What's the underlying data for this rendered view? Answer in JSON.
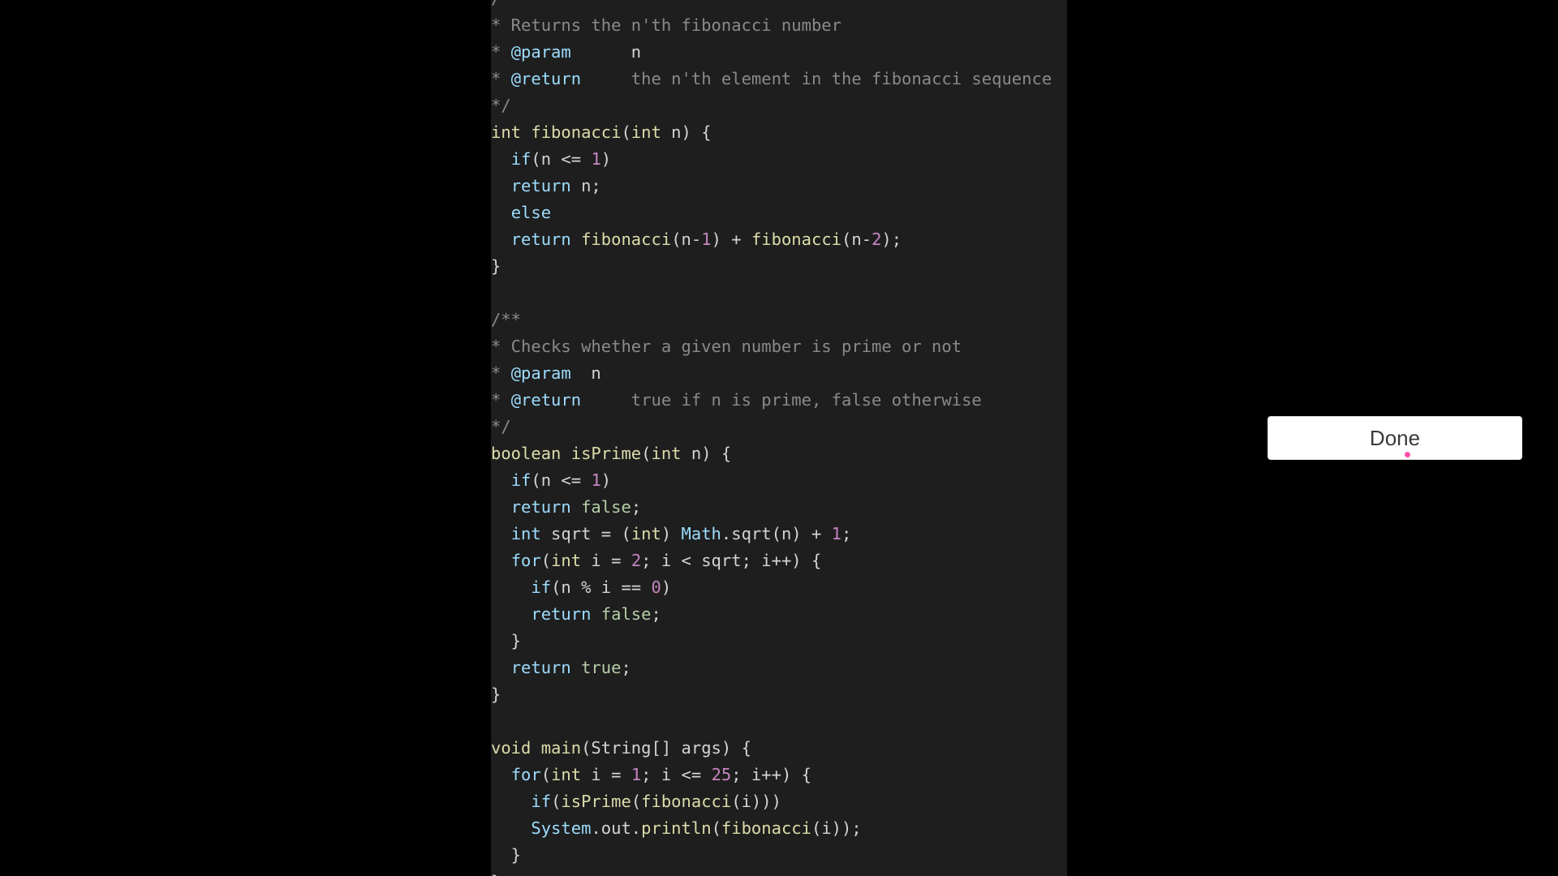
{
  "editor": {
    "lines": [
      [
        {
          "t": "/",
          "c": "comment"
        }
      ],
      [
        {
          "t": "* Returns the n'th fibonacci number",
          "c": "comment"
        }
      ],
      [
        {
          "t": "* ",
          "c": "comment"
        },
        {
          "t": "@param",
          "c": "tag"
        },
        {
          "t": "      n",
          "c": "punct"
        }
      ],
      [
        {
          "t": "* ",
          "c": "comment"
        },
        {
          "t": "@return",
          "c": "tag"
        },
        {
          "t": "     the n'th element in the fibonacci sequence",
          "c": "comment"
        }
      ],
      [
        {
          "t": "*/",
          "c": "comment"
        }
      ],
      [
        {
          "t": "int ",
          "c": "fn"
        },
        {
          "t": "fibonacci",
          "c": "fn"
        },
        {
          "t": "(",
          "c": "punct"
        },
        {
          "t": "int",
          "c": "fn"
        },
        {
          "t": " n) {",
          "c": "punct"
        }
      ],
      [
        {
          "t": "  ",
          "c": "punct"
        },
        {
          "t": "if",
          "c": "kw"
        },
        {
          "t": "(n <= ",
          "c": "punct"
        },
        {
          "t": "1",
          "c": "num"
        },
        {
          "t": ")",
          "c": "punct"
        }
      ],
      [
        {
          "t": "  ",
          "c": "punct"
        },
        {
          "t": "return",
          "c": "kw"
        },
        {
          "t": " n;",
          "c": "punct"
        }
      ],
      [
        {
          "t": "  ",
          "c": "punct"
        },
        {
          "t": "else",
          "c": "kw"
        }
      ],
      [
        {
          "t": "  ",
          "c": "punct"
        },
        {
          "t": "return",
          "c": "kw"
        },
        {
          "t": " ",
          "c": "punct"
        },
        {
          "t": "fibonacci",
          "c": "fn"
        },
        {
          "t": "(n-",
          "c": "punct"
        },
        {
          "t": "1",
          "c": "num"
        },
        {
          "t": ") + ",
          "c": "punct"
        },
        {
          "t": "fibonacci",
          "c": "fn"
        },
        {
          "t": "(n-",
          "c": "punct"
        },
        {
          "t": "2",
          "c": "num"
        },
        {
          "t": ");",
          "c": "punct"
        }
      ],
      [
        {
          "t": "}",
          "c": "punct"
        }
      ],
      [
        {
          "t": "",
          "c": "punct"
        }
      ],
      [
        {
          "t": "/**",
          "c": "comment"
        }
      ],
      [
        {
          "t": "* Checks whether a given number is prime or not",
          "c": "comment"
        }
      ],
      [
        {
          "t": "* ",
          "c": "comment"
        },
        {
          "t": "@param",
          "c": "tag"
        },
        {
          "t": "  n",
          "c": "punct"
        }
      ],
      [
        {
          "t": "* ",
          "c": "comment"
        },
        {
          "t": "@return",
          "c": "tag"
        },
        {
          "t": "     true if n is prime, false otherwise",
          "c": "comment"
        }
      ],
      [
        {
          "t": "*/",
          "c": "comment"
        }
      ],
      [
        {
          "t": "boolean ",
          "c": "fn"
        },
        {
          "t": "isPrime",
          "c": "fn"
        },
        {
          "t": "(",
          "c": "punct"
        },
        {
          "t": "int",
          "c": "fn"
        },
        {
          "t": " n) {",
          "c": "punct"
        }
      ],
      [
        {
          "t": "  ",
          "c": "punct"
        },
        {
          "t": "if",
          "c": "kw"
        },
        {
          "t": "(n <= ",
          "c": "punct"
        },
        {
          "t": "1",
          "c": "num"
        },
        {
          "t": ")",
          "c": "punct"
        }
      ],
      [
        {
          "t": "  ",
          "c": "punct"
        },
        {
          "t": "return",
          "c": "kw"
        },
        {
          "t": " ",
          "c": "punct"
        },
        {
          "t": "false",
          "c": "lit"
        },
        {
          "t": ";",
          "c": "punct"
        }
      ],
      [
        {
          "t": "  ",
          "c": "punct"
        },
        {
          "t": "int",
          "c": "kw"
        },
        {
          "t": " sqrt = (",
          "c": "punct"
        },
        {
          "t": "int",
          "c": "fn"
        },
        {
          "t": ") ",
          "c": "punct"
        },
        {
          "t": "Math",
          "c": "tag"
        },
        {
          "t": ".sqrt(n) + ",
          "c": "punct"
        },
        {
          "t": "1",
          "c": "num"
        },
        {
          "t": ";",
          "c": "punct"
        }
      ],
      [
        {
          "t": "  ",
          "c": "punct"
        },
        {
          "t": "for",
          "c": "kw"
        },
        {
          "t": "(",
          "c": "punct"
        },
        {
          "t": "int",
          "c": "fn"
        },
        {
          "t": " i = ",
          "c": "punct"
        },
        {
          "t": "2",
          "c": "num"
        },
        {
          "t": "; i < sqrt; i++) {",
          "c": "punct"
        }
      ],
      [
        {
          "t": "    ",
          "c": "punct"
        },
        {
          "t": "if",
          "c": "kw"
        },
        {
          "t": "(n % i == ",
          "c": "punct"
        },
        {
          "t": "0",
          "c": "num"
        },
        {
          "t": ")",
          "c": "punct"
        }
      ],
      [
        {
          "t": "    ",
          "c": "punct"
        },
        {
          "t": "return",
          "c": "kw"
        },
        {
          "t": " ",
          "c": "punct"
        },
        {
          "t": "false",
          "c": "lit"
        },
        {
          "t": ";",
          "c": "punct"
        }
      ],
      [
        {
          "t": "  }",
          "c": "punct"
        }
      ],
      [
        {
          "t": "  ",
          "c": "punct"
        },
        {
          "t": "return",
          "c": "kw"
        },
        {
          "t": " ",
          "c": "punct"
        },
        {
          "t": "true",
          "c": "lit"
        },
        {
          "t": ";",
          "c": "punct"
        }
      ],
      [
        {
          "t": "}",
          "c": "punct"
        }
      ],
      [
        {
          "t": "",
          "c": "punct"
        }
      ],
      [
        {
          "t": "void ",
          "c": "fn"
        },
        {
          "t": "main",
          "c": "fn"
        },
        {
          "t": "(String[] args) {",
          "c": "punct"
        }
      ],
      [
        {
          "t": "  ",
          "c": "punct"
        },
        {
          "t": "for",
          "c": "kw"
        },
        {
          "t": "(",
          "c": "punct"
        },
        {
          "t": "int",
          "c": "fn"
        },
        {
          "t": " i = ",
          "c": "punct"
        },
        {
          "t": "1",
          "c": "num"
        },
        {
          "t": "; i <= ",
          "c": "punct"
        },
        {
          "t": "25",
          "c": "num"
        },
        {
          "t": "; i++) {",
          "c": "punct"
        }
      ],
      [
        {
          "t": "    ",
          "c": "punct"
        },
        {
          "t": "if",
          "c": "kw"
        },
        {
          "t": "(",
          "c": "punct"
        },
        {
          "t": "isPrime",
          "c": "fn"
        },
        {
          "t": "(",
          "c": "punct"
        },
        {
          "t": "fibonacci",
          "c": "fn"
        },
        {
          "t": "(i)))",
          "c": "punct"
        }
      ],
      [
        {
          "t": "    ",
          "c": "punct"
        },
        {
          "t": "System",
          "c": "tag"
        },
        {
          "t": ".out.",
          "c": "punct"
        },
        {
          "t": "println",
          "c": "fn"
        },
        {
          "t": "(",
          "c": "punct"
        },
        {
          "t": "fibonacci",
          "c": "fn"
        },
        {
          "t": "(i));",
          "c": "punct"
        }
      ],
      [
        {
          "t": "  }",
          "c": "punct"
        }
      ],
      [
        {
          "t": "}",
          "c": "punct"
        }
      ]
    ]
  },
  "done_button": {
    "label": "Done"
  },
  "colors": {
    "background": "#000000",
    "editor_background": "#1e1e1e",
    "cursor_accent": "#ff4fa8"
  }
}
